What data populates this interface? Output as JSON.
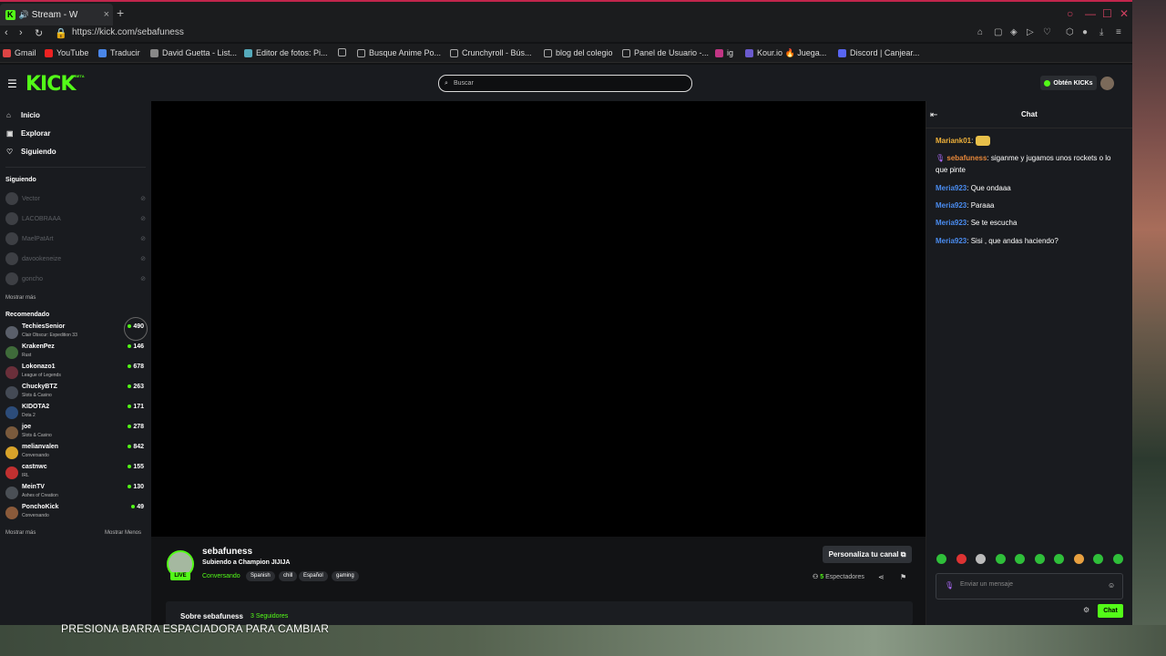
{
  "browser": {
    "tab_title": "Stream - W",
    "url": "https://kick.com/sebafuness",
    "bookmarks": [
      "Gmail",
      "YouTube",
      "Traducir",
      "David Guetta - List...",
      "Editor de fotos: Pi...",
      "",
      "Busque Anime Po...",
      "Crunchyroll - Bús...",
      "blog del colegio",
      "Panel de Usuario -...",
      "ig",
      "Kour.io 🔥 Juega...",
      "Discord | Canjear..."
    ]
  },
  "header": {
    "logo": "KICK",
    "beta": "BETA",
    "search_placeholder": "Buscar",
    "get_kicks": "Obtén KICKs"
  },
  "sidebar": {
    "nav": [
      "Inicio",
      "Explorar",
      "Siguiendo"
    ],
    "following_title": "Siguiendo",
    "following": [
      "Vector",
      "LACOBRAAA",
      "MaelPatArt",
      "davookeneize",
      "goncho"
    ],
    "show_more": "Mostrar más",
    "recommended_title": "Recomendado",
    "recommended": [
      {
        "name": "TechiesSenior",
        "category": "Clair Obscur: Expedition 33",
        "viewers": "490",
        "color": "#5a5f6a"
      },
      {
        "name": "KrakenPez",
        "category": "Rust",
        "viewers": "146",
        "color": "#3f6b3a"
      },
      {
        "name": "Lokonazo1",
        "category": "League of Legends",
        "viewers": "678",
        "color": "#6a2f3a"
      },
      {
        "name": "ChuckyBTZ",
        "category": "Slots & Casino",
        "viewers": "263",
        "color": "#444a55"
      },
      {
        "name": "KIDOTA2",
        "category": "Dota 2",
        "viewers": "171",
        "color": "#2c4c7a"
      },
      {
        "name": "joe",
        "category": "Slots & Casino",
        "viewers": "278",
        "color": "#7a5a3c"
      },
      {
        "name": "melianvalen",
        "category": "Conversando",
        "viewers": "842",
        "color": "#d8a32a"
      },
      {
        "name": "castnwc",
        "category": "IRL",
        "viewers": "155",
        "color": "#c03030"
      },
      {
        "name": "MeinTV",
        "category": "Ashes of Creation",
        "viewers": "130",
        "color": "#4a4f55"
      },
      {
        "name": "PonchoKick",
        "category": "Conversando",
        "viewers": "49",
        "color": "#8a5a3a"
      }
    ],
    "show_less": "Mostrar Menos"
  },
  "stream": {
    "channel": "sebafuness",
    "live": "LIVE",
    "title": "Subiendo a Champion JIJIJA",
    "category": "Conversando",
    "tags": [
      "Spanish",
      "chill",
      "Español",
      "gaming"
    ],
    "customize": "Personaliza tu canal",
    "viewers": "5",
    "viewers_label": "Espectadores",
    "about": "Sobre sebafuness",
    "followers": "3 Seguidores"
  },
  "chat": {
    "title": "Chat",
    "messages": [
      {
        "user": "Mariank01",
        "text": " ",
        "color": "#f0b23a"
      },
      {
        "user": "sebafuness",
        "text": "siganme y jugamos unos rockets o lo que pinte",
        "color": "#e8883a"
      },
      {
        "user": "Meria923",
        "text": "Que ondaaa",
        "color": "#4a8cf0"
      },
      {
        "user": "Meria923",
        "text": "Paraaa",
        "color": "#4a8cf0"
      },
      {
        "user": "Meria923",
        "text": "Se te escucha",
        "color": "#4a8cf0"
      },
      {
        "user": "Meria923",
        "text": "Sisi , que andas haciendo?",
        "color": "#4a8cf0"
      }
    ],
    "placeholder": "Enviar un mensaje",
    "send": "Chat"
  },
  "overlay": {
    "hint": "PRESIONA BARRA ESPACIADORA PARA CAMBIAR"
  }
}
